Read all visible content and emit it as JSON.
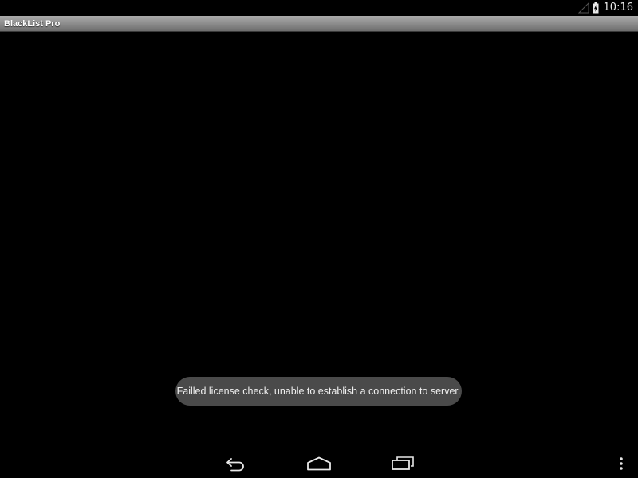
{
  "status_bar": {
    "time": "10:16",
    "icons": [
      "signal-icon",
      "battery-charging-icon"
    ]
  },
  "title_bar": {
    "title": "BlackList Pro"
  },
  "toast": {
    "message": "Failled license check, unable to establish a connection to server."
  },
  "nav_bar": {
    "buttons": [
      "back-icon",
      "home-icon",
      "recents-icon",
      "overflow-menu-icon"
    ]
  },
  "colors": {
    "background": "#000000",
    "title_bar": "#8a8a8a",
    "toast_background": "#4a4a4a",
    "text": "#ffffff"
  }
}
